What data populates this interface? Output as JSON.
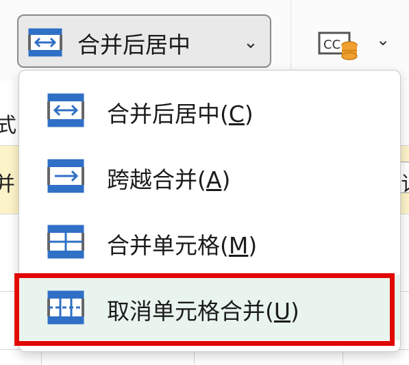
{
  "colors": {
    "icon_blue": "#2f6fc5",
    "icon_gray": "#666666",
    "highlight_red": "#e10600",
    "selected_row": "#e9f4ee",
    "cc_icon_orange": "#f0a030"
  },
  "background": {
    "left_text_top": "式",
    "left_text_mid": "并",
    "right_text": "订"
  },
  "toolbar": {
    "merge_button": {
      "label": "合并后居中",
      "icon": "merge-center-icon",
      "chevron": "⌄"
    },
    "cc_button": {
      "icon": "cc-database-icon",
      "chevron": "⌄"
    }
  },
  "menu": {
    "items": [
      {
        "label": "合并后居中(",
        "accel": "C",
        "close": ")",
        "icon": "merge-center-icon",
        "selected": false
      },
      {
        "label": "跨越合并(",
        "accel": "A",
        "close": ")",
        "icon": "merge-across-icon",
        "selected": false
      },
      {
        "label": "合并单元格(",
        "accel": "M",
        "close": ")",
        "icon": "merge-cells-icon",
        "selected": false
      },
      {
        "label": "取消单元格合并(",
        "accel": "U",
        "close": ")",
        "icon": "unmerge-cells-icon",
        "selected": true
      }
    ]
  }
}
